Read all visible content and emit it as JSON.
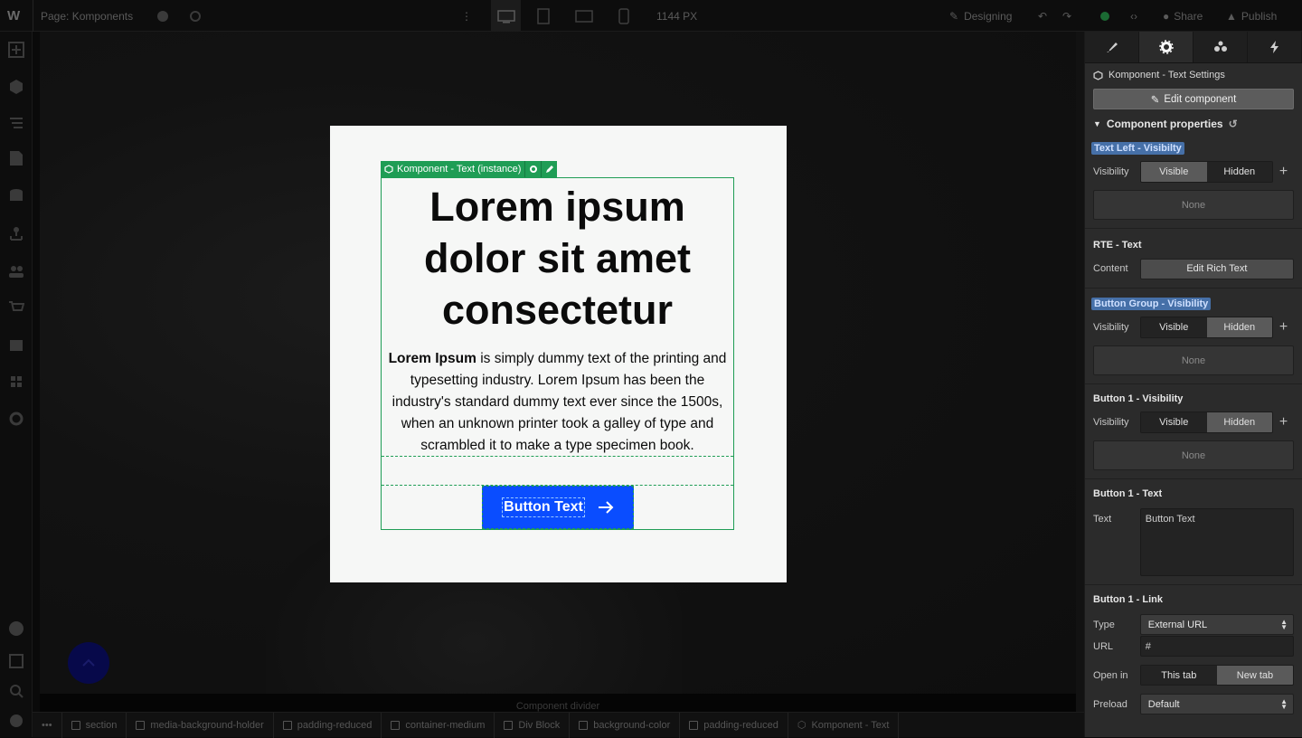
{
  "topbar": {
    "logo": "W",
    "page_label": "Page: Komponents",
    "width_readout": "1144 PX",
    "mode_label": "Designing",
    "share_label": "Share",
    "publish_label": "Publish"
  },
  "canvas": {
    "component_tag": "Komponent - Text (instance)",
    "headline": "Lorem ipsum dolor sit amet consectetur",
    "para_bold": "Lorem Ipsum",
    "para_rest": " is simply dummy text of the printing and typesetting industry. Lorem Ipsum has been the industry's standard dummy text ever since the 1500s, when an unknown printer took a galley of type and scrambled it to make a type specimen book.",
    "button_text": "Button Text",
    "divider_label": "Component divider"
  },
  "breadcrumb": [
    "section",
    "media-background-holder",
    "padding-reduced",
    "container-medium",
    "Div Block",
    "background-color",
    "padding-reduced",
    "Komponent - Text"
  ],
  "panel": {
    "title": "Komponent - Text Settings",
    "edit_component": "Edit component",
    "section_title": "Component properties",
    "g1": {
      "title": "Text Left - Visibilty",
      "label": "Visibility",
      "opt_a": "Visible",
      "opt_b": "Hidden",
      "none": "None"
    },
    "g2": {
      "title": "RTE - Text",
      "label": "Content",
      "button": "Edit Rich Text"
    },
    "g3": {
      "title": "Button Group - Visibility",
      "label": "Visibility",
      "opt_a": "Visible",
      "opt_b": "Hidden",
      "none": "None"
    },
    "g4": {
      "title": "Button 1 - Visibility",
      "label": "Visibility",
      "opt_a": "Visible",
      "opt_b": "Hidden",
      "none": "None"
    },
    "g5": {
      "title": "Button 1 - Text",
      "label": "Text",
      "value": "Button Text"
    },
    "g6": {
      "title": "Button 1 - Link",
      "type_label": "Type",
      "type_value": "External URL",
      "url_label": "URL",
      "url_value": "#",
      "open_label": "Open in",
      "open_a": "This tab",
      "open_b": "New tab",
      "preload_label": "Preload",
      "preload_value": "Default"
    }
  },
  "colors": {
    "accent_green": "#1f9d55",
    "button_blue": "#0a4dff",
    "highlight": "#4670a8"
  }
}
